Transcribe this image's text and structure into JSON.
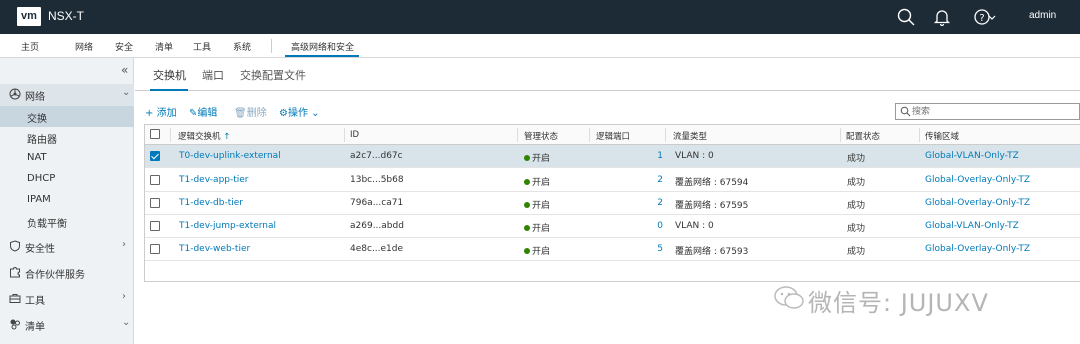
{
  "header": {
    "logo": "vm",
    "title": "NSX-T",
    "user": "admin",
    "icons": [
      "search-icon",
      "bell-icon",
      "help-icon",
      "chevron-down-icon"
    ]
  },
  "mainnav": {
    "items": [
      "主页",
      "网络",
      "安全",
      "清单",
      "工具",
      "系统"
    ],
    "advanced": "高级网络和安全"
  },
  "sidebar": {
    "collapse": "«",
    "network": "网络",
    "items": [
      "交换",
      "路由器",
      "NAT",
      "DHCP",
      "IPAM",
      "负载平衡"
    ],
    "security": "安全性",
    "partner": "合作伙伴服务",
    "tools": "工具",
    "inventory": "清单"
  },
  "tabs": [
    "交换机",
    "端口",
    "交换配置文件"
  ],
  "toolbar": {
    "add": "添加",
    "edit": "编辑",
    "delete": "删除",
    "actions": "操作",
    "search_placeholder": "搜索"
  },
  "table": {
    "headers": [
      "逻辑交换机",
      "ID",
      "管理状态",
      "逻辑端口",
      "流量类型",
      "配置状态",
      "传输区域"
    ],
    "rows": [
      {
        "name": "T0-dev-uplink-external",
        "id": "a2c7...d67c",
        "admin": "开启",
        "ports": "1",
        "traffic": "VLAN : 0",
        "status": "成功",
        "zone": "Global-VLAN-Only-TZ",
        "selected": true
      },
      {
        "name": "T1-dev-app-tier",
        "id": "13bc...5b68",
        "admin": "开启",
        "ports": "2",
        "traffic": "覆盖网络 : 67594",
        "status": "成功",
        "zone": "Global-Overlay-Only-TZ",
        "selected": false
      },
      {
        "name": "T1-dev-db-tier",
        "id": "796a...ca71",
        "admin": "开启",
        "ports": "2",
        "traffic": "覆盖网络 : 67595",
        "status": "成功",
        "zone": "Global-Overlay-Only-TZ",
        "selected": false
      },
      {
        "name": "T1-dev-jump-external",
        "id": "a269...abdd",
        "admin": "开启",
        "ports": "0",
        "traffic": "VLAN : 0",
        "status": "成功",
        "zone": "Global-VLAN-Only-TZ",
        "selected": false
      },
      {
        "name": "T1-dev-web-tier",
        "id": "4e8c...e1de",
        "admin": "开启",
        "ports": "5",
        "traffic": "覆盖网络 : 67593",
        "status": "成功",
        "zone": "Global-Overlay-Only-TZ",
        "selected": false
      }
    ]
  },
  "watermark": "微信号: JUJUXV",
  "colors": {
    "header_bg": "#1c2b36",
    "accent": "#0079b8",
    "status_green": "#2f8400"
  }
}
